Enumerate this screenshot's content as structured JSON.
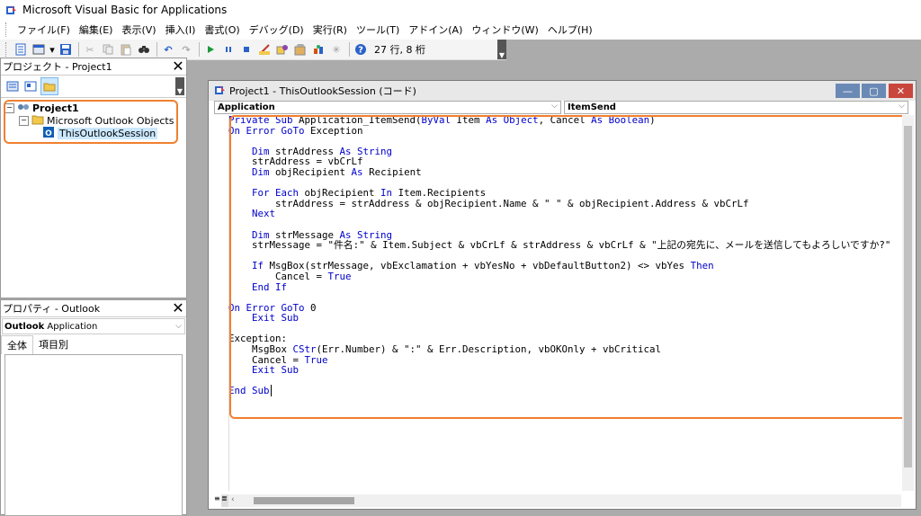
{
  "window": {
    "title": "Microsoft Visual Basic for Applications"
  },
  "menu": [
    "ファイル(F)",
    "編集(E)",
    "表示(V)",
    "挿入(I)",
    "書式(O)",
    "デバッグ(D)",
    "実行(R)",
    "ツール(T)",
    "アドイン(A)",
    "ウィンドウ(W)",
    "ヘルプ(H)"
  ],
  "toolbar": {
    "position": "27 行, 8 桁"
  },
  "project": {
    "header": "プロジェクト - Project1",
    "root": "Project1",
    "folder": "Microsoft Outlook Objects",
    "module": "ThisOutlookSession"
  },
  "properties": {
    "header": "プロパティ - Outlook",
    "object_name": "Outlook",
    "object_type": "Application",
    "tab_all": "全体",
    "tab_category": "項目別"
  },
  "code_window": {
    "title": "Project1 - ThisOutlookSession (コード)",
    "object_combo": "Application",
    "proc_combo": "ItemSend",
    "lines": [
      [
        {
          "t": "Private Sub ",
          "k": 1
        },
        {
          "t": "Application_ItemSend(",
          "k": 0
        },
        {
          "t": "ByVal ",
          "k": 1
        },
        {
          "t": "Item ",
          "k": 0
        },
        {
          "t": "As Object",
          "k": 1
        },
        {
          "t": ", Cancel ",
          "k": 0
        },
        {
          "t": "As Boolean",
          "k": 1
        },
        {
          "t": ")",
          "k": 0
        }
      ],
      [
        {
          "t": "On Error GoTo ",
          "k": 1
        },
        {
          "t": "Exception",
          "k": 0
        }
      ],
      [
        {
          "t": "",
          "k": 0
        }
      ],
      [
        {
          "t": "    ",
          "k": 0
        },
        {
          "t": "Dim ",
          "k": 1
        },
        {
          "t": "strAddress ",
          "k": 0
        },
        {
          "t": "As String",
          "k": 1
        }
      ],
      [
        {
          "t": "    strAddress = vbCrLf",
          "k": 0
        }
      ],
      [
        {
          "t": "    ",
          "k": 0
        },
        {
          "t": "Dim ",
          "k": 1
        },
        {
          "t": "objRecipient ",
          "k": 0
        },
        {
          "t": "As ",
          "k": 1
        },
        {
          "t": "Recipient",
          "k": 0
        }
      ],
      [
        {
          "t": "",
          "k": 0
        }
      ],
      [
        {
          "t": "    ",
          "k": 0
        },
        {
          "t": "For Each ",
          "k": 1
        },
        {
          "t": "objRecipient ",
          "k": 0
        },
        {
          "t": "In ",
          "k": 1
        },
        {
          "t": "Item.Recipients",
          "k": 0
        }
      ],
      [
        {
          "t": "        strAddress = strAddress & objRecipient.Name & \" \" & objRecipient.Address & vbCrLf",
          "k": 0
        }
      ],
      [
        {
          "t": "    ",
          "k": 0
        },
        {
          "t": "Next",
          "k": 1
        }
      ],
      [
        {
          "t": "",
          "k": 0
        }
      ],
      [
        {
          "t": "    ",
          "k": 0
        },
        {
          "t": "Dim ",
          "k": 1
        },
        {
          "t": "strMessage ",
          "k": 0
        },
        {
          "t": "As String",
          "k": 1
        }
      ],
      [
        {
          "t": "    strMessage = \"件名:\" & Item.Subject & vbCrLf & strAddress & vbCrLf & \"上記の宛先に、メールを送信してもよろしいですか?\"",
          "k": 0
        }
      ],
      [
        {
          "t": "",
          "k": 0
        }
      ],
      [
        {
          "t": "    ",
          "k": 0
        },
        {
          "t": "If ",
          "k": 1
        },
        {
          "t": "MsgBox(strMessage, vbExclamation + vbYesNo + vbDefaultButton2) <> vbYes ",
          "k": 0
        },
        {
          "t": "Then",
          "k": 1
        }
      ],
      [
        {
          "t": "        Cancel = ",
          "k": 0
        },
        {
          "t": "True",
          "k": 1
        }
      ],
      [
        {
          "t": "    ",
          "k": 0
        },
        {
          "t": "End If",
          "k": 1
        }
      ],
      [
        {
          "t": "",
          "k": 0
        }
      ],
      [
        {
          "t": "On Error GoTo ",
          "k": 1
        },
        {
          "t": "0",
          "k": 0
        }
      ],
      [
        {
          "t": "    ",
          "k": 0
        },
        {
          "t": "Exit Sub",
          "k": 1
        }
      ],
      [
        {
          "t": "",
          "k": 0
        }
      ],
      [
        {
          "t": "Exception:",
          "k": 0
        }
      ],
      [
        {
          "t": "    MsgBox ",
          "k": 0
        },
        {
          "t": "CStr",
          "k": 1
        },
        {
          "t": "(Err.Number) & \":\" & Err.Description, vbOKOnly + vbCritical",
          "k": 0
        }
      ],
      [
        {
          "t": "    Cancel = ",
          "k": 0
        },
        {
          "t": "True",
          "k": 1
        }
      ],
      [
        {
          "t": "    ",
          "k": 0
        },
        {
          "t": "Exit Sub",
          "k": 1
        }
      ],
      [
        {
          "t": "",
          "k": 0
        }
      ],
      [
        {
          "t": "End Sub",
          "k": 1
        }
      ]
    ]
  },
  "colors": {
    "keyword": "#0000cc",
    "highlight": "#f08030",
    "selection": "#cce8ff"
  }
}
